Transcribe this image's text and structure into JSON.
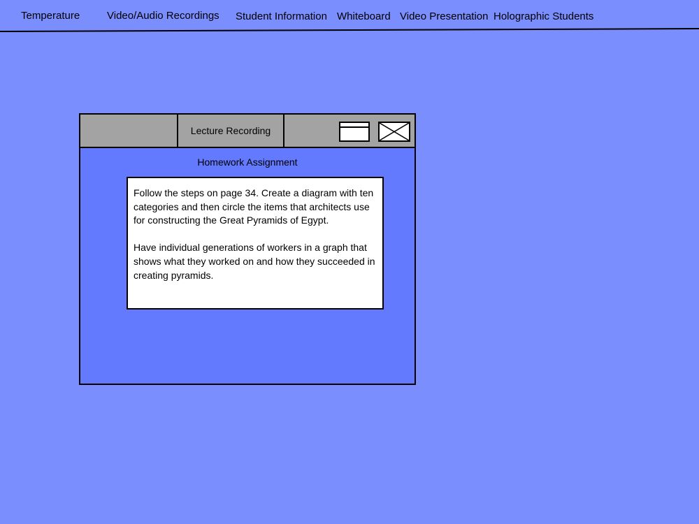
{
  "nav": {
    "items": [
      {
        "label": "Temperature"
      },
      {
        "label": "Video/Audio Recordings"
      },
      {
        "label": "Student Information"
      },
      {
        "label": "Whiteboard"
      },
      {
        "label": "Video Presentation"
      },
      {
        "label": "Holographic Students"
      }
    ]
  },
  "window": {
    "tab_label": "Lecture Recording",
    "heading": "Homework Assignment",
    "paragraphs": [
      "Follow the steps on page 34. Create a diagram with ten categories and then circle the items that architects use for constructing the Great Pyramids of Egypt.",
      "Have individual generations of workers in a graph that shows what they worked on and how they succeeded in creating pyramids."
    ],
    "maximize_icon": "maximize-icon",
    "close_icon": "close-icon"
  },
  "colors": {
    "background": "#7b8efe",
    "window_body": "#6379fe",
    "titlebar": "#a3a3a3"
  }
}
